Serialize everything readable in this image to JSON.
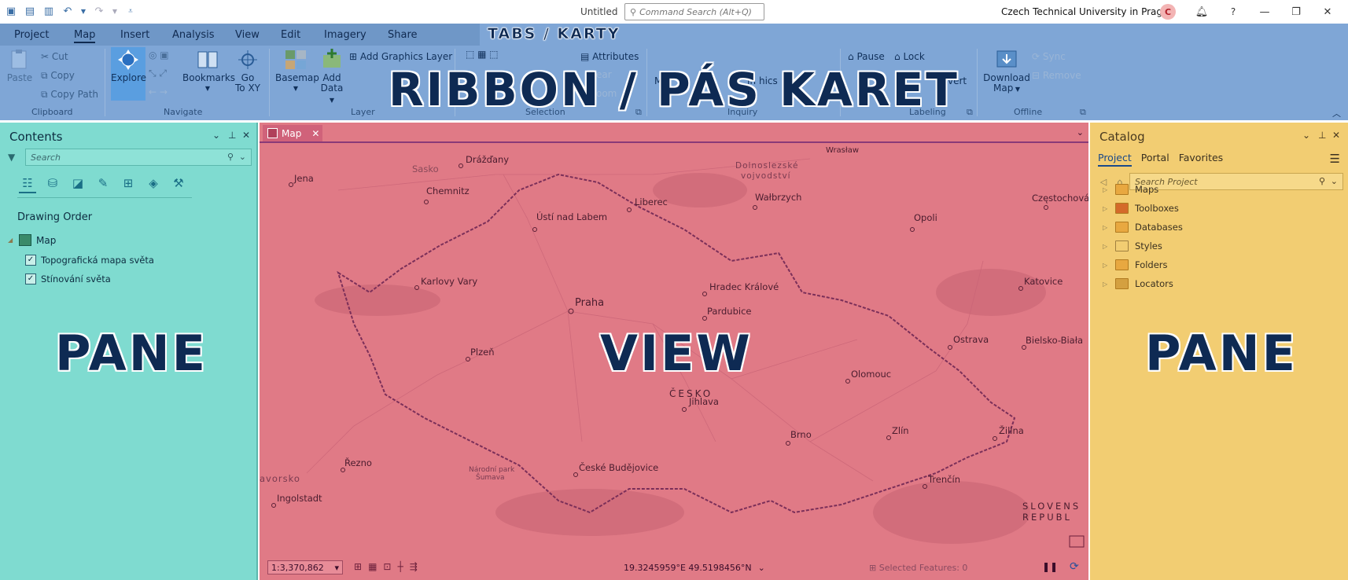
{
  "titlebar": {
    "app_title": "Untitled",
    "command_search_placeholder": "Command Search (Alt+Q)",
    "organization": "Czech Technical University in Prague",
    "avatar_initial": "C",
    "help_label": "?"
  },
  "ribbon": {
    "tabs": [
      {
        "label": "Project"
      },
      {
        "label": "Map"
      },
      {
        "label": "Insert"
      },
      {
        "label": "Analysis"
      },
      {
        "label": "View"
      },
      {
        "label": "Edit"
      },
      {
        "label": "Imagery"
      },
      {
        "label": "Share"
      }
    ],
    "active_tab": "Map",
    "tabs_overlay_label": "TABS / KARTY",
    "ribbon_overlay_label": "RIBBON / PÁS KARET",
    "clipboard": {
      "paste": "Paste",
      "cut": "Cut",
      "copy": "Copy",
      "copy_path": "Copy Path",
      "group": "Clipboard"
    },
    "navigate": {
      "explore": "Explore",
      "bookmarks": "Bookmarks",
      "goto_line1": "Go",
      "goto_line2": "To XY",
      "group": "Navigate"
    },
    "layer": {
      "basemap": "Basemap",
      "add_line1": "Add",
      "add_line2": "Data",
      "add_graphics": "Add Graphics Layer",
      "group": "Layer"
    },
    "selection": {
      "attributes": "Attributes",
      "clear": "ear",
      "zoom": "oom",
      "group": "Selection"
    },
    "inquiry": {
      "measure": "M",
      "infographics": "In  hics",
      "group": "Inquiry"
    },
    "labeling": {
      "pause": "Pause",
      "lock": "Lock",
      "convert": "vert",
      "group": "Labeling"
    },
    "offline": {
      "download_line1": "Download",
      "download_line2": "Map",
      "sync": "Sync",
      "remove": "Remove",
      "group": "Offline"
    }
  },
  "contents_pane": {
    "title": "Contents",
    "search_placeholder": "Search",
    "drawing_order": "Drawing Order",
    "map_label": "Map",
    "layers": [
      {
        "name": "Topografická mapa světa",
        "checked": true
      },
      {
        "name": "Stínování světa",
        "checked": true
      }
    ],
    "overlay_label": "PANE"
  },
  "map_view": {
    "tab_label": "Map",
    "overlay_label": "VIEW",
    "country_label": "ČESKO",
    "region_label_line1": "Dolnoslezské",
    "region_label_line2": "vojvodství",
    "slovakia_line1": "SLOVENS",
    "slovakia_line2": "REPUBL",
    "np_line1": "Národní park",
    "np_line2": "Šumava",
    "cities": [
      {
        "name": "Drážďany"
      },
      {
        "name": "Sasko"
      },
      {
        "name": "Jena"
      },
      {
        "name": "Chemnitz"
      },
      {
        "name": "Wrasław"
      },
      {
        "name": "Wałbrzych"
      },
      {
        "name": "Liberec"
      },
      {
        "name": "Ústí nad Labem"
      },
      {
        "name": "Opoli"
      },
      {
        "name": "Częstochová"
      },
      {
        "name": "Karlovy Vary"
      },
      {
        "name": "Hradec Králové"
      },
      {
        "name": "Praha"
      },
      {
        "name": "Pardubice"
      },
      {
        "name": "Katovice"
      },
      {
        "name": "Ostrava"
      },
      {
        "name": "Bielsko-Biała"
      },
      {
        "name": "Plzeň"
      },
      {
        "name": "Olomouc"
      },
      {
        "name": "Jihlava"
      },
      {
        "name": "Brno"
      },
      {
        "name": "Zlín"
      },
      {
        "name": "Žilina"
      },
      {
        "name": "Řezno"
      },
      {
        "name": "České Budějovice"
      },
      {
        "name": "Trenčín"
      },
      {
        "name": "avorsko"
      },
      {
        "name": "Ingolstadt"
      }
    ],
    "scale": "1:3,370,862",
    "coordinates": "19.3245959°E 49.5198456°N",
    "selected_features": "Selected Features: 0"
  },
  "catalog_pane": {
    "title": "Catalog",
    "tabs": [
      {
        "label": "Project"
      },
      {
        "label": "Portal"
      },
      {
        "label": "Favorites"
      }
    ],
    "active_tab": "Project",
    "search_placeholder": "Search Project",
    "items": [
      {
        "label": "Maps"
      },
      {
        "label": "Toolboxes"
      },
      {
        "label": "Databases"
      },
      {
        "label": "Styles"
      },
      {
        "label": "Folders"
      },
      {
        "label": "Locators"
      }
    ],
    "overlay_label": "PANE"
  },
  "colors": {
    "ribbon": "#7fa6d6",
    "contents_pane": "#7fdbd0",
    "view": "#e07a86",
    "catalog_pane": "#f2cd72",
    "overlay_text": "#0e2a53"
  }
}
